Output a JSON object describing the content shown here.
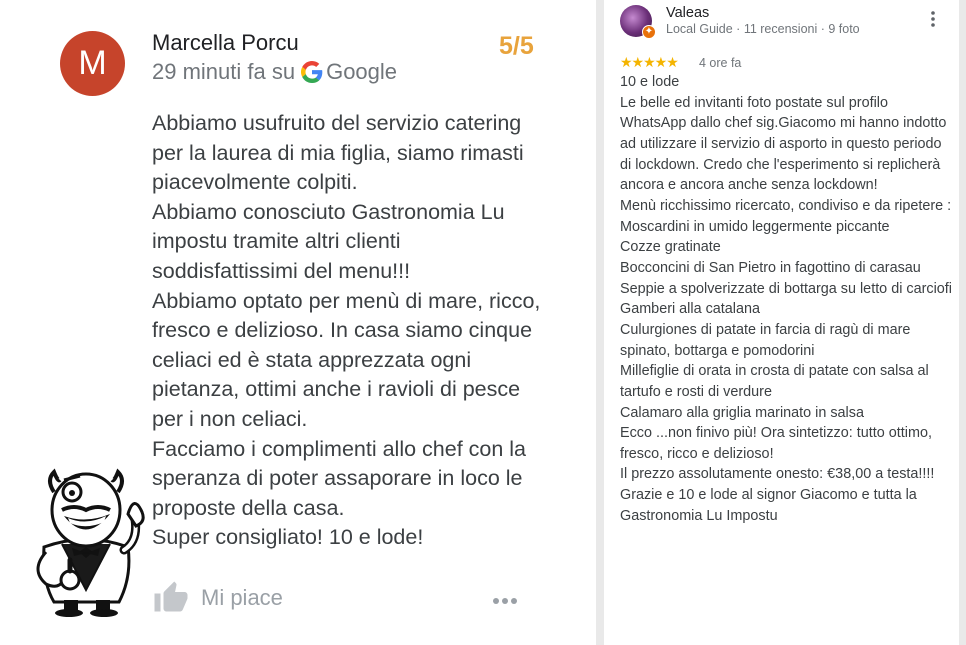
{
  "left_review": {
    "avatar_letter": "M",
    "author": "Marcella Porcu",
    "time": "29 minuti fa su",
    "source": "Google",
    "score": "5/5",
    "paragraphs": [
      "Abbiamo usufruito del servizio catering per la laurea di mia figlia, siamo rimasti piacevolmente colpiti.",
      "Abbiamo conosciuto Gastronomia Lu impostu tramite altri clienti soddisfattissimi del menu!!!",
      "Abbiamo optato per menù di mare, ricco, fresco e delizioso. In casa siamo cinque celiaci ed è stata apprezzata ogni pietanza, ottimi anche i ravioli di pesce per i non celiaci.",
      "Facciamo i complimenti allo chef con la speranza di poter assaporare in loco le proposte della casa.",
      "Super consigliato! 10 e lode!"
    ],
    "like_label": "Mi piace",
    "colors": {
      "avatar": "#c6442b",
      "score": "#e8a33c"
    }
  },
  "right_review": {
    "author": "Valeas",
    "meta": "Local Guide · 11 recensioni · 9 foto",
    "stars": "★★★★★",
    "rating": 5,
    "time": "4 ore fa",
    "lines": [
      "10 e lode",
      "Le belle ed invitanti foto postate sul profilo WhatsApp dallo chef sig.Giacomo mi hanno indotto ad utilizzare il servizio di asporto in questo periodo di lockdown. Credo che l'esperimento si replicherà ancora e ancora anche senza lockdown!",
      "Menù ricchissimo ricercato, condiviso e da ripetere :",
      "Moscardini in umido leggermente piccante",
      "Cozze gratinate",
      "Bocconcini di San Pietro in fagottino di carasau",
      "Seppie a spolverizzate di bottarga su letto di carciofi",
      "Gamberi alla catalana",
      "Culurgiones di patate in farcia di ragù di mare spinato, bottarga e pomodorini",
      "Millefiglie di orata in crosta di patate con salsa al tartufo e rosti di verdure",
      "Calamaro alla griglia marinato in salsa",
      "Ecco ...non finivo più!  Ora sintetizzo: tutto ottimo, fresco, ricco e delizioso!",
      "Il prezzo assolutamente onesto: €38,00 a testa!!!!",
      "Grazie e 10 e lode al signor Giacomo e tutta la Gastronomia Lu Impostu"
    ],
    "colors": {
      "stars": "#f4b400",
      "badge": "#e8710a"
    }
  }
}
